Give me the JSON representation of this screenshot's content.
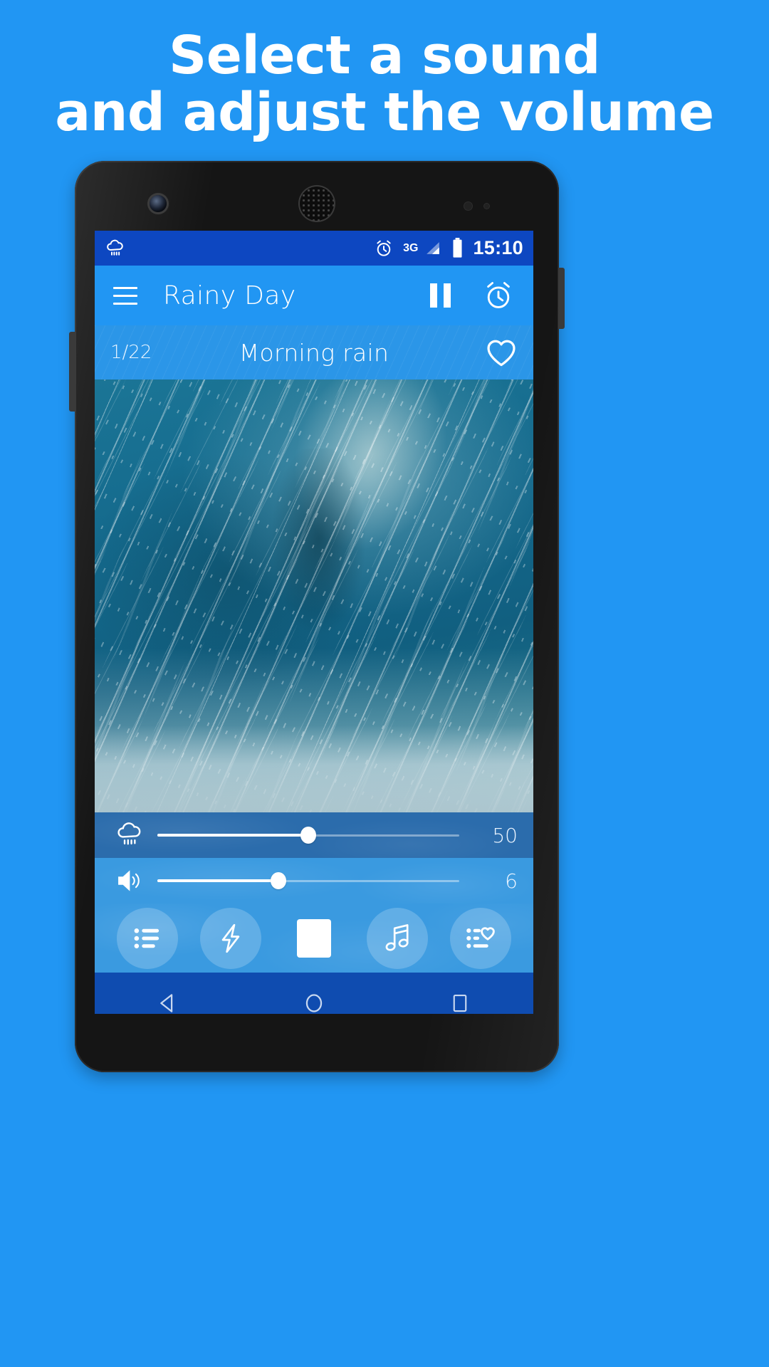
{
  "promo": {
    "line1": "Select a sound",
    "line2": "and adjust the volume",
    "background_color": "#2196f3",
    "text_color": "#ffffff"
  },
  "device": {
    "frame_color": "#151515",
    "icons": {
      "front_camera": "camera-icon",
      "earpiece": "speaker-grille-icon",
      "proximity_sensor": "proximity-sensor-icon",
      "volume_rocker": "volume-rocker-button",
      "power_button": "power-button"
    }
  },
  "status_bar": {
    "background_color": "#0d47c1",
    "notification_icon": "rain-cloud-icon",
    "alarm_icon": "alarm-clock-icon",
    "network_label": "3G",
    "signal_icon": "signal-bars-icon",
    "battery_icon": "battery-full-icon",
    "time": "15:10"
  },
  "app_bar": {
    "background_color": "#2196f3",
    "menu_icon": "hamburger-menu-icon",
    "title": "Rainy Day",
    "pause_icon": "pause-icon",
    "alarm_icon": "alarm-clock-icon"
  },
  "track_bar": {
    "background_color": "#2b96e8",
    "index": "1/22",
    "name": "Morning rain",
    "favorite_icon": "heart-outline-icon"
  },
  "artwork": {
    "description": "rain-photo",
    "alt": "Heavy rain falling"
  },
  "sliders": [
    {
      "id": "sound-volume",
      "icon": "rain-cloud-icon",
      "value": "50",
      "percent": 50,
      "background_color": "#2b6cac"
    },
    {
      "id": "master-volume",
      "icon": "speaker-volume-icon",
      "value": "6",
      "percent": 40,
      "background_color": "#3a9ae0"
    }
  ],
  "action_bar": {
    "background_color": "#3a9ae0",
    "buttons": [
      {
        "id": "sound-list",
        "icon": "list-icon",
        "label": "Sound list"
      },
      {
        "id": "effects",
        "icon": "lightning-bolt-icon",
        "label": "Effects"
      },
      {
        "id": "stop",
        "icon": "stop-square-icon",
        "label": "Stop"
      },
      {
        "id": "music",
        "icon": "music-note-icon",
        "label": "Music"
      },
      {
        "id": "favorites-list",
        "icon": "list-heart-icon",
        "label": "Favorites"
      }
    ]
  },
  "nav_bar": {
    "background_color": "#0f4cb0",
    "buttons": [
      {
        "id": "back",
        "icon": "back-triangle-icon"
      },
      {
        "id": "home",
        "icon": "home-circle-icon"
      },
      {
        "id": "recents",
        "icon": "recents-square-icon"
      }
    ]
  }
}
